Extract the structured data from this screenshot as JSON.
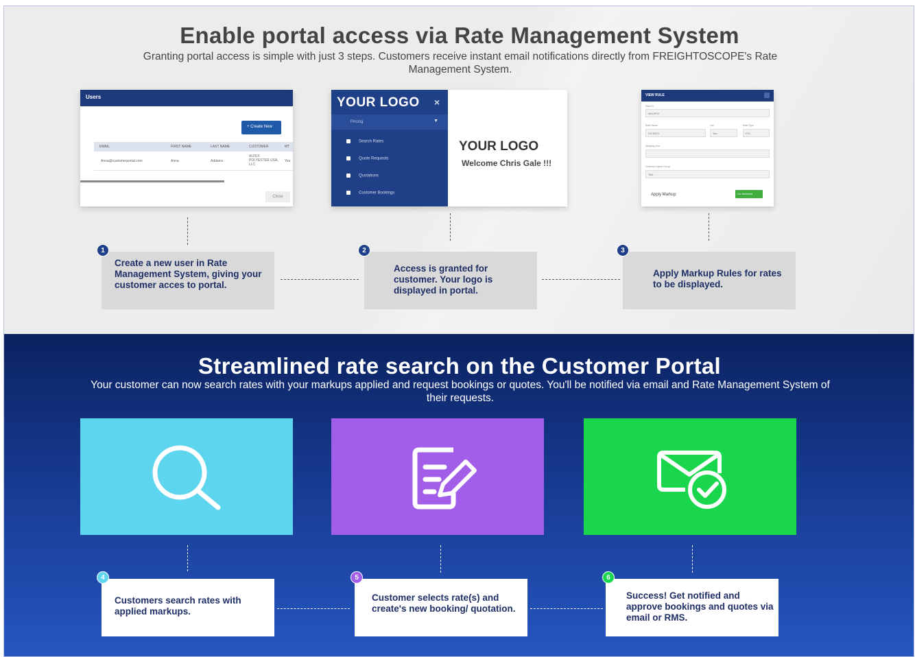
{
  "top": {
    "title": "Enable portal access via Rate Management System",
    "subtitle": "Granting portal access is simple with just 3 steps. Customers receive instant email notifications directly from FREIGHTOSCOPE's Rate Management System.",
    "screens": {
      "users": {
        "title": "Users",
        "create_button": "+ Create New",
        "columns": [
          "EMAIL",
          "FIRST NAME",
          "LAST NAME",
          "CUSTOMER",
          "MT"
        ],
        "row": [
          "Anna@customerportal.com",
          "Anna",
          "Addams",
          "ALFEX POLYESTER USA, LLC",
          "Yes"
        ],
        "close_button": "Close"
      },
      "portal": {
        "logo": "YOUR LOGO",
        "close_glyph": "×",
        "section": "Pricing",
        "menu": [
          "Search Rates",
          "Quote Requests",
          "Quotations",
          "Customer Bookings"
        ],
        "brand": "YOUR LOGO",
        "welcome": "Welcome Chris Gale !!!"
      },
      "view_rule": {
        "title": "VIEW RULE",
        "fields": [
          "Rate ID",
          "Rate Name",
          "Our",
          "Rate Type",
          "Shipping Line",
          "Customer Agent Group"
        ],
        "values": [
          "MKUP02",
          "DH 8310",
          "Yes",
          "FCL",
          "",
          "Test"
        ],
        "apply_label": "Apply Markup",
        "apply_button": "Un-Selected"
      }
    },
    "steps": [
      {
        "number": "1",
        "text": "Create a new user in Rate Management System, giving your customer acces to portal."
      },
      {
        "number": "2",
        "text": "Access is granted for customer. Your logo is displayed in portal."
      },
      {
        "number": "3",
        "text": "Apply Markup Rules for rates to be displayed."
      }
    ]
  },
  "bottom": {
    "title": "Streamlined rate search on the Customer Portal",
    "subtitle": "Your customer can now search rates with your markups applied and request bookings or quotes. You'll be notified via email and Rate Management System of their requests.",
    "tiles": [
      {
        "icon": "search-icon",
        "color": "#5ed5ef"
      },
      {
        "icon": "edit-document-icon",
        "color": "#a35ee9"
      },
      {
        "icon": "mail-check-icon",
        "color": "#19d64c"
      }
    ],
    "steps": [
      {
        "number": "4",
        "text": "Customers search rates with applied markups.",
        "color": "#5ed5ef"
      },
      {
        "number": "5",
        "text": "Customer selects rate(s) and create's new booking/ quotation.",
        "color": "#a35ee9"
      },
      {
        "number": "6",
        "text": "Success! Get notified and approve bookings and quotes via email or RMS.",
        "color": "#19d64c"
      }
    ]
  }
}
